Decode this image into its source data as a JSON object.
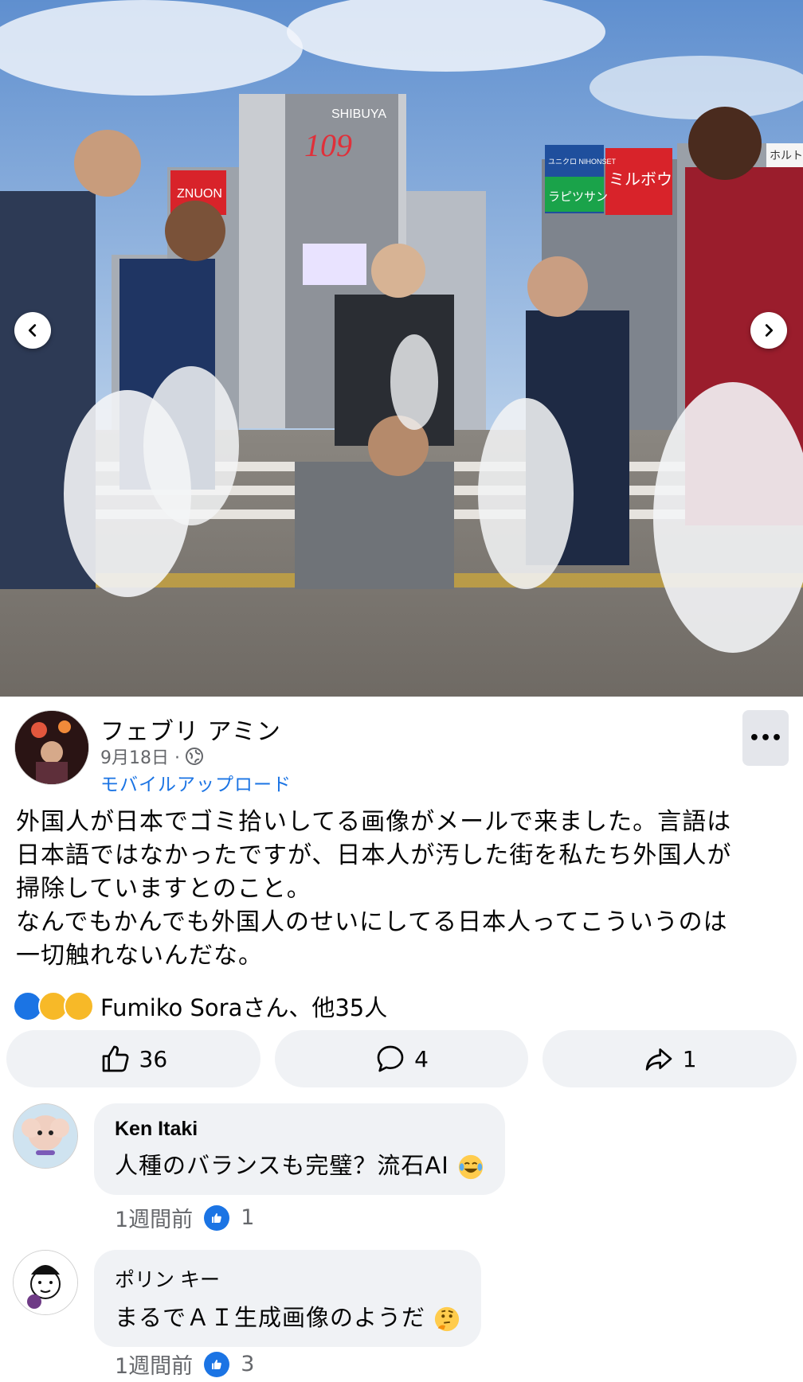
{
  "photo": {
    "sign_shibuya": "SHIBUYA",
    "sign_109": "109",
    "sign_left": "ZNUON",
    "sign_right_red": "ミルボウ",
    "sign_right_green": "ラピツサン",
    "sign_right_blue": "ユニクロ NIHONSET",
    "sign_far_right": "ホルト"
  },
  "post": {
    "author": "フェブリ アミン",
    "date": "9月18日 ·",
    "source": "モバイルアップロード",
    "more_label": "•••",
    "text": "外国人が日本でゴミ拾いしてる画像がメールで来ました。言語は\n日本語ではなかったですが、日本人が汚した街を私たち外国人が\n掃除していますとのこと。\nなんでもかんでも外国人のせいにしてる日本人ってこういうのは\n一切触れないんだな。",
    "reactions_text": "Fumiko Soraさん、他35人"
  },
  "actions": {
    "like_count": "36",
    "comment_count": "4",
    "share_count": "1"
  },
  "comments": [
    {
      "name": "Ken Itaki",
      "text": "人種のバランスも完璧？流石AI",
      "emoji": "laughing-tears-emoji",
      "time": "1週間前",
      "likes": "1"
    },
    {
      "name": "ポリン キー",
      "text": "まるでＡＩ生成画像のようだ",
      "emoji": "thinking-face-emoji",
      "time": "1週間前",
      "likes": "3"
    }
  ],
  "colors": {
    "link_blue": "#1b74e4",
    "meta_gray": "#65676b",
    "bubble_bg": "#f0f2f5",
    "like_blue": "#1b74e4"
  }
}
